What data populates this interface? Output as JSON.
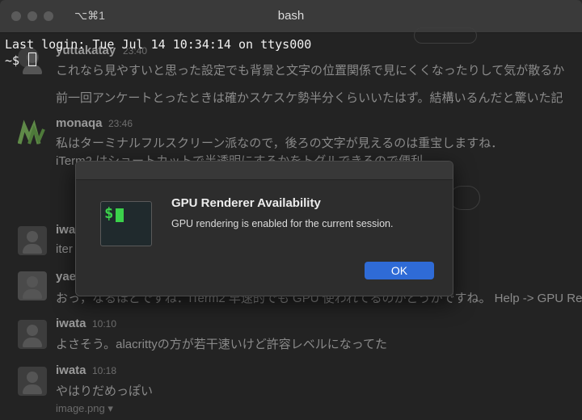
{
  "window": {
    "title": "bash",
    "shortcut": "⌥⌘1"
  },
  "terminal": {
    "line1": "Last login: Tue Jul 14 10:34:14 on ttys000",
    "prompt": "~$ "
  },
  "background_chat": {
    "partial_name_top": "yuttakatay",
    "partial_time_top": "23:40",
    "msg_top_1": "これなら見やすいと思った設定でも背景と文字の位置関係で見にくくなったりして気が散るか",
    "msg_top_2": "前一回アンケートとったときは確かスケスケ勢半分くらいいたはず。結構いるんだと驚いた記",
    "monaqa_name": "monaqa",
    "monaqa_time": "23:46",
    "monaqa_msg_1": "私はターミナルフルスクリーン派なので，後ろの文字が見えるのは重宝しますね．",
    "monaqa_msg_2": "iTerm2 はショートカットで半透明にするかをトグルできるので便利．",
    "iwata_a_name": "iwata",
    "iwata_a_text": "iter",
    "yae_name": "yae",
    "yae_msg": "おっ，なるほどですね．iTerm2 早速的でも GPU 使われてるのかどうかですね。 Help -> GPU Render",
    "iwata_b_name": "iwata",
    "iwata_b_time": "10:10",
    "iwata_b_msg": "よさそう。alacrittyの方が若干速いけど許容レベルになってた",
    "iwata_c_name": "iwata",
    "iwata_c_time": "10:18",
    "iwata_c_msg": "やはりだめっぽい",
    "attachment": "image.png ▾"
  },
  "dialog": {
    "title": "GPU Renderer Availability",
    "message": "GPU rendering is enabled for the current session.",
    "ok_label": "OK",
    "icon_text": "$"
  },
  "colors": {
    "accent": "#2f6bd6",
    "terminal_green": "#3bd14b"
  }
}
